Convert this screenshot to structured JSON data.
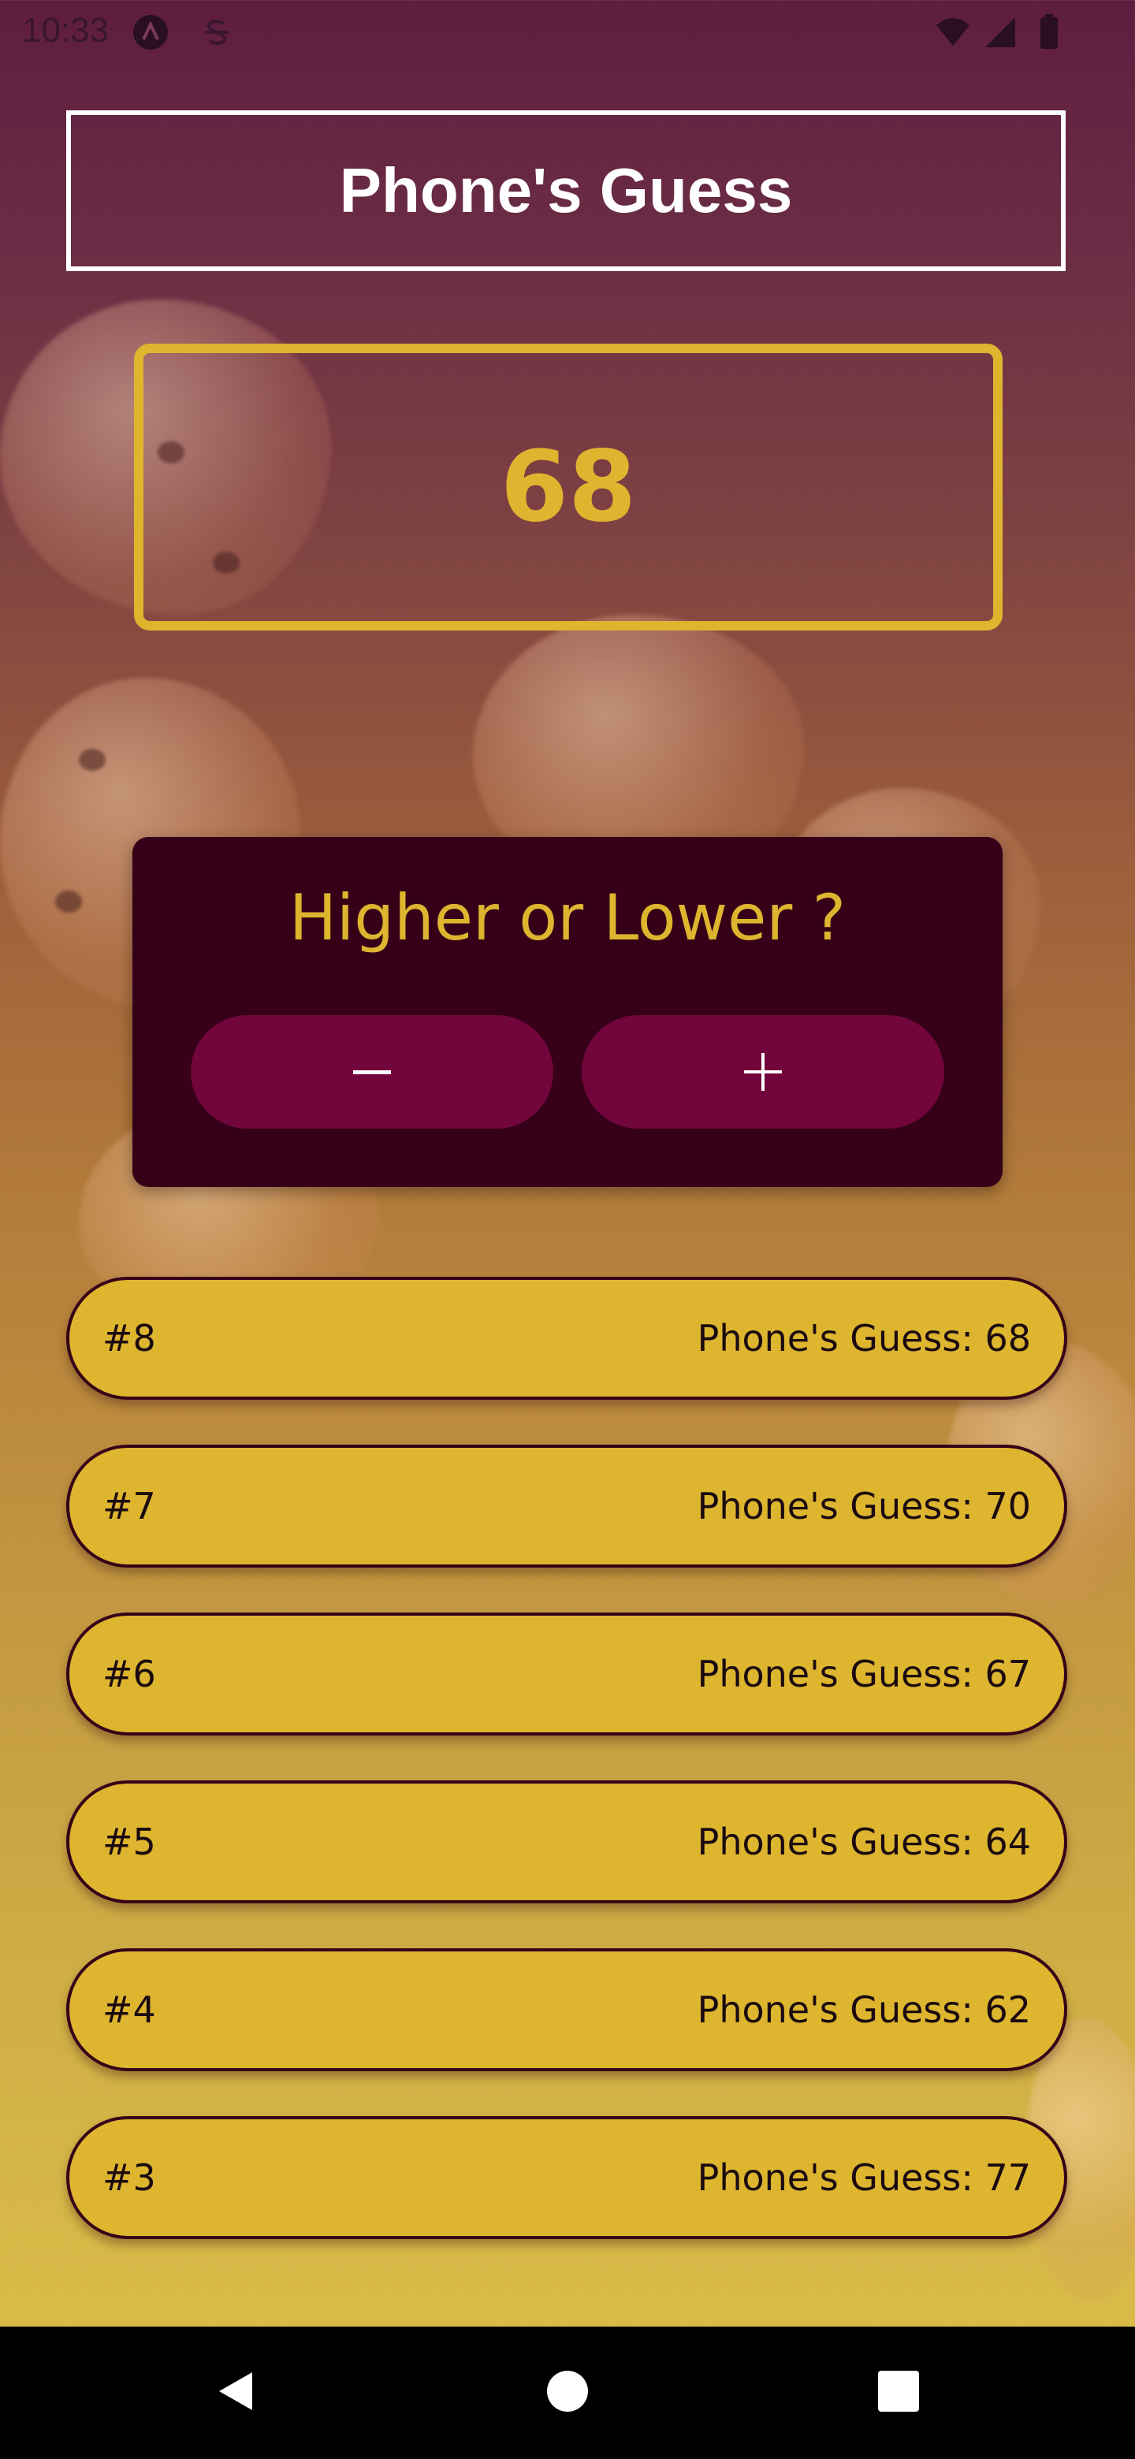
{
  "status_bar": {
    "time": "10:33",
    "icons": [
      "a-circle-icon",
      "s-strike-icon",
      "wifi-icon",
      "signal-icon",
      "battery-icon"
    ]
  },
  "header": {
    "title": "Phone's Guess"
  },
  "guess": {
    "value": "68"
  },
  "controls": {
    "prompt": "Higher or Lower ?",
    "lower_icon": "minus-icon",
    "higher_icon": "plus-icon"
  },
  "log": [
    {
      "round": "#8",
      "guess": "Phone's Guess: 68"
    },
    {
      "round": "#7",
      "guess": "Phone's Guess: 70"
    },
    {
      "round": "#6",
      "guess": "Phone's Guess: 67"
    },
    {
      "round": "#5",
      "guess": "Phone's Guess: 64"
    },
    {
      "round": "#4",
      "guess": "Phone's Guess: 62"
    },
    {
      "round": "#3",
      "guess": "Phone's Guess: 77"
    }
  ],
  "nav_bar": {
    "icons": [
      "back-icon",
      "home-icon",
      "recents-icon"
    ]
  },
  "colors": {
    "accent": "#ddb52f",
    "card": "#350018",
    "button": "#72063c"
  }
}
